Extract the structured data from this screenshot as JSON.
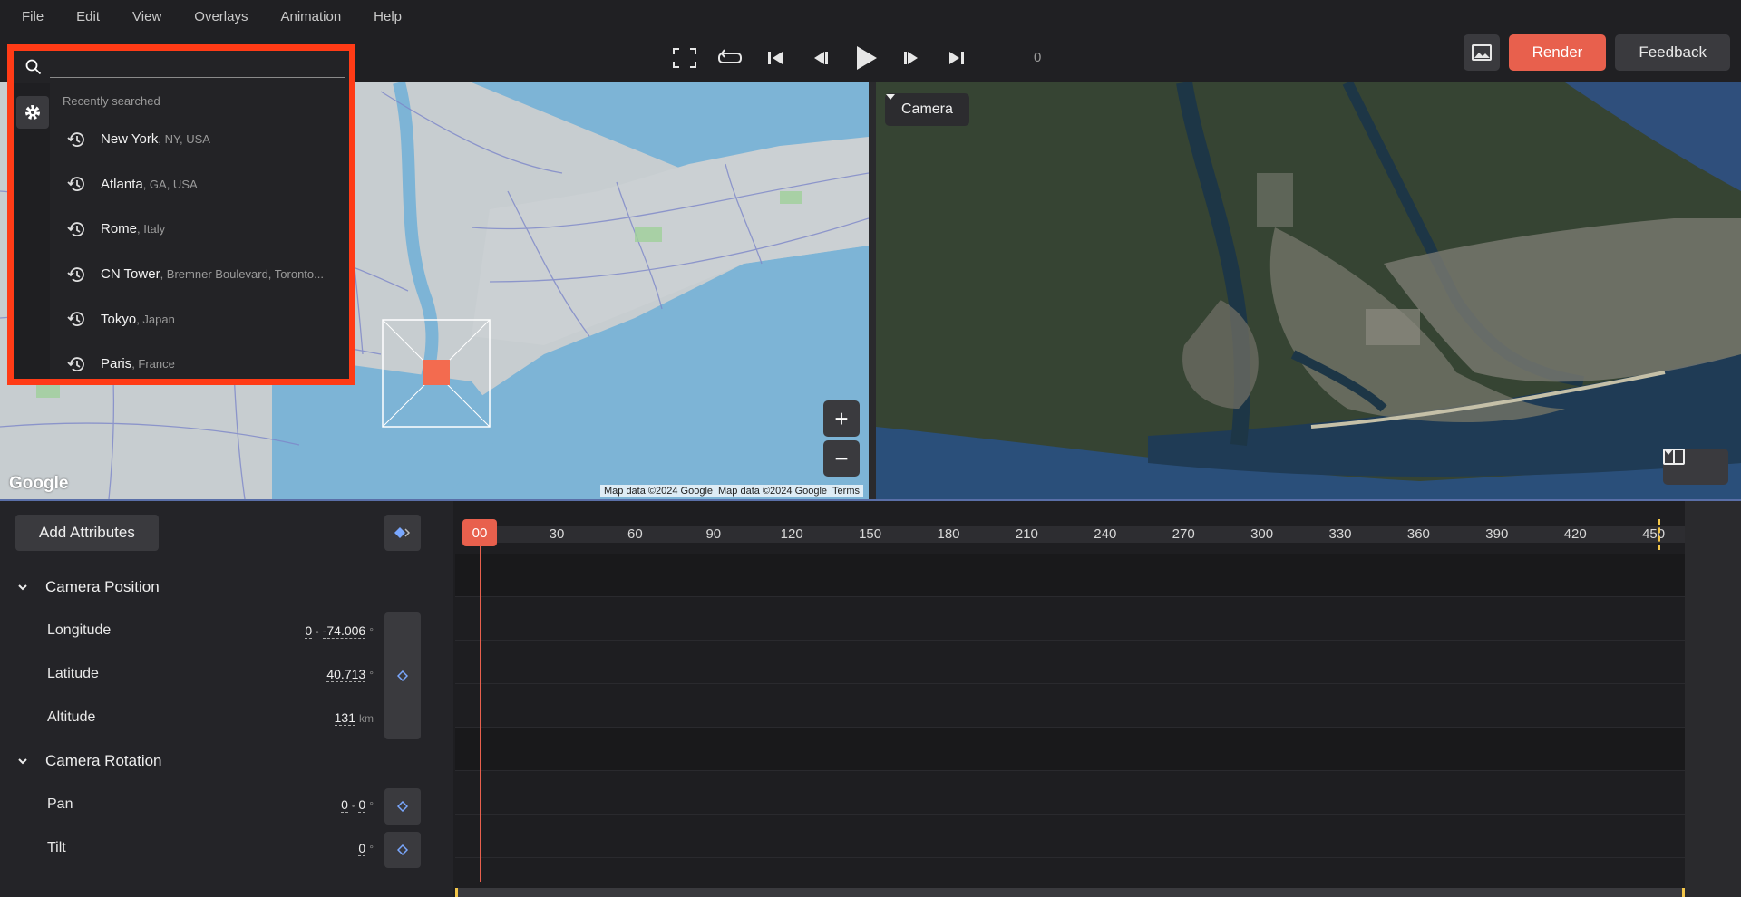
{
  "menu": [
    "File",
    "Edit",
    "View",
    "Overlays",
    "Animation",
    "Help"
  ],
  "toolbar": {
    "frame": "0",
    "render_label": "Render",
    "feedback_label": "Feedback"
  },
  "search": {
    "value": "",
    "heading": "Recently searched",
    "items": [
      {
        "name": "New York",
        "sub": ", NY, USA"
      },
      {
        "name": "Atlanta",
        "sub": ", GA, USA"
      },
      {
        "name": "Rome",
        "sub": ", Italy"
      },
      {
        "name": "CN Tower",
        "sub": ", Bremner Boulevard, Toronto..."
      },
      {
        "name": "Tokyo",
        "sub": ", Japan"
      },
      {
        "name": "Paris",
        "sub": ", France"
      }
    ]
  },
  "map": {
    "google_logo": "Google",
    "attr1": "Map data ©2024 Google",
    "attr2": "Map data ©2024 Google",
    "terms": "Terms",
    "zoom_in": "+",
    "zoom_out": "−"
  },
  "camera_view": {
    "label": "Camera"
  },
  "timeline": {
    "add_attributes": "Add Attributes",
    "playhead": "00",
    "ticks": [
      "30",
      "60",
      "90",
      "120",
      "150",
      "180",
      "210",
      "240",
      "270",
      "300",
      "330",
      "360",
      "390",
      "420",
      "450"
    ],
    "groups": [
      {
        "name": "Camera Position",
        "attrs": [
          {
            "label": "Longitude",
            "v1": "0",
            "v2": "-74.006",
            "unit": "°"
          },
          {
            "label": "Latitude",
            "v2": "40.713",
            "unit": "°"
          },
          {
            "label": "Altitude",
            "v2": "131",
            "unit": "km"
          }
        ]
      },
      {
        "name": "Camera Rotation",
        "attrs": [
          {
            "label": "Pan",
            "v1": "0",
            "v2": "0",
            "unit": "°"
          },
          {
            "label": "Tilt",
            "v2": "0",
            "unit": "°"
          }
        ]
      }
    ]
  },
  "colors": {
    "accent": "#e8604d",
    "highlight": "#ff3b16",
    "keyframe": "#7aa8ff"
  }
}
